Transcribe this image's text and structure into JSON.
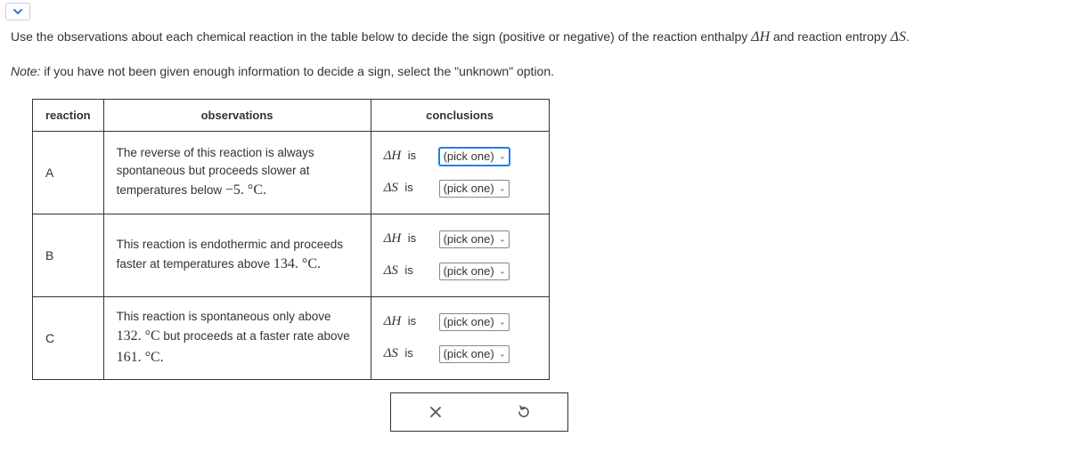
{
  "toggle_icon": "chevron-down-icon",
  "intro": {
    "line1_a": "Use the observations about each chemical reaction in the table below to decide the sign (positive or negative) of the reaction enthalpy ",
    "dH_sym": "Δ",
    "dH_var": "H",
    "line1_b": " and reaction entropy ",
    "dS_sym": "Δ",
    "dS_var": "S",
    "line1_c": "."
  },
  "note": {
    "prefix": "Note:",
    "rest": " if you have not been given enough information to decide a sign, select the \"unknown\" option."
  },
  "headers": {
    "reaction": "reaction",
    "observations": "observations",
    "conclusions": "conclusions"
  },
  "labels": {
    "dH": "ΔH",
    "dS": "ΔS",
    "is": "is",
    "pick": "(pick one)"
  },
  "rows": [
    {
      "id": "A",
      "obs_a": "The reverse of this reaction is always spontaneous but proceeds slower at temperatures below ",
      "num": "−5.",
      "unit": " °C."
    },
    {
      "id": "B",
      "obs_a": "This reaction is endothermic and proceeds faster at temperatures above ",
      "num": "134.",
      "unit": " °C."
    },
    {
      "id": "C",
      "obs_a": "This reaction is spontaneous only above ",
      "num1": "132.",
      "unit1": " °C",
      "obs_b": " but proceeds at a faster rate above ",
      "num2": "161.",
      "unit2": " °C."
    }
  ],
  "actions": {
    "close": "×",
    "reset": "↺"
  }
}
